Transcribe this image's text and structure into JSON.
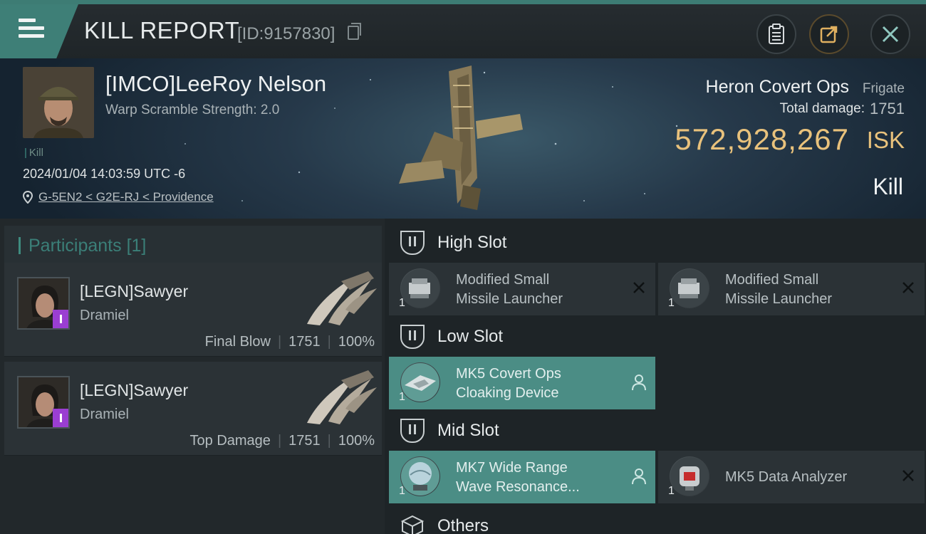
{
  "header": {
    "title": "KILL REPORT",
    "report_id": "[ID:9157830]",
    "buttons": [
      "clipboard-icon",
      "share-icon",
      "close-icon"
    ]
  },
  "victim": {
    "name": "[IMCO]LeeRoy Nelson",
    "warp_scramble": "Warp Scramble Strength: 2.0",
    "kill_tag": "Kill",
    "datetime": "2024/01/04 14:03:59 UTC -6",
    "location": "G-5EN2 < G2E-RJ < Providence",
    "ship_name": "Heron Covert Ops",
    "ship_class": "Frigate",
    "total_damage_label": "Total damage:",
    "total_damage": "1751",
    "isk_value": "572,928,267",
    "isk_unit": "ISK",
    "result": "Kill"
  },
  "participants": {
    "title": "Participants",
    "count": "[1]",
    "rows": [
      {
        "name": "[LEGN]Sawyer",
        "ship": "Dramiel",
        "role": "Final Blow",
        "damage": "1751",
        "percent": "100%"
      },
      {
        "name": "[LEGN]Sawyer",
        "ship": "Dramiel",
        "role": "Top Damage",
        "damage": "1751",
        "percent": "100%"
      }
    ]
  },
  "slots": {
    "high": {
      "label": "High Slot",
      "modules": [
        {
          "qty": "1",
          "line1": "Modified Small",
          "line2": "Missile Launcher"
        },
        {
          "qty": "1",
          "line1": "Modified Small",
          "line2": "Missile Launcher"
        }
      ]
    },
    "low": {
      "label": "Low Slot",
      "modules": [
        {
          "qty": "1",
          "line1": "MK5 Covert Ops",
          "line2": "Cloaking Device"
        }
      ]
    },
    "mid": {
      "label": "Mid Slot",
      "modules": [
        {
          "qty": "1",
          "line1": "MK7 Wide Range",
          "line2": "Wave Resonance..."
        },
        {
          "qty": "1",
          "line1": "MK5 Data Analyzer",
          "line2": ""
        }
      ]
    },
    "others": {
      "label": "Others"
    }
  },
  "colors": {
    "accent": "#3e7f77",
    "isk": "#e9c27c",
    "highlight": "#4b8d85",
    "badge": "#9a3ed2"
  }
}
